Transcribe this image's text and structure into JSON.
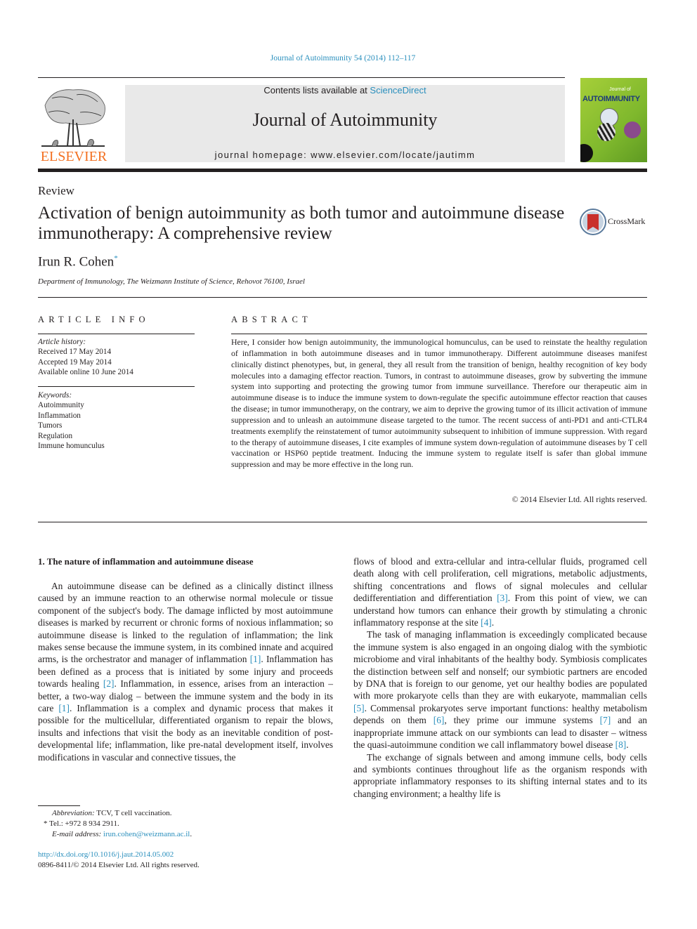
{
  "header": {
    "journal_reference": "Journal of Autoimmunity 54 (2014) 112–117",
    "contents_prefix": "Contents lists available at ",
    "contents_link": "ScienceDirect",
    "journal_name": "Journal of Autoimmunity",
    "homepage": "journal homepage: www.elsevier.com/locate/jautimm",
    "publisher_logo_text": "ELSEVIER",
    "cover": {
      "line1": "Journal of",
      "line2": "AUTOIMMUNITY"
    },
    "colors": {
      "link": "#2a8fbd",
      "publisher_orange": "#f37021",
      "band_gray": "#e9e9e9",
      "cover_green": "#8cc63f"
    }
  },
  "article": {
    "section_type": "Review",
    "title": "Activation of benign autoimmunity as both tumor and autoimmune disease immunotherapy: A comprehensive review",
    "crossmark_label": "CrossMark",
    "author": "Irun R. Cohen",
    "author_mark": "*",
    "affiliation": "Department of Immunology, The Weizmann Institute of Science, Rehovot 76100, Israel"
  },
  "article_info": {
    "heading": "ARTICLE INFO",
    "history_label": "Article history:",
    "history": [
      "Received 17 May 2014",
      "Accepted 19 May 2014",
      "Available online 10 June 2014"
    ],
    "keywords_label": "Keywords:",
    "keywords": [
      "Autoimmunity",
      "Inflammation",
      "Tumors",
      "Regulation",
      "Immune homunculus"
    ]
  },
  "abstract": {
    "heading": "ABSTRACT",
    "text": "Here, I consider how benign autoimmunity, the immunological homunculus, can be used to reinstate the healthy regulation of inflammation in both autoimmune diseases and in tumor immunotherapy. Different autoimmune diseases manifest clinically distinct phenotypes, but, in general, they all result from the transition of benign, healthy recognition of key body molecules into a damaging effector reaction. Tumors, in contrast to autoimmune diseases, grow by subverting the immune system into supporting and protecting the growing tumor from immune surveillance. Therefore our therapeutic aim in autoimmune disease is to induce the immune system to down-regulate the specific autoimmune effector reaction that causes the disease; in tumor immunotherapy, on the contrary, we aim to deprive the growing tumor of its illicit activation of immune suppression and to unleash an autoimmune disease targeted to the tumor. The recent success of anti-PD1 and anti-CTLR4 treatments exemplify the reinstatement of tumor autoimmunity subsequent to inhibition of immune suppression. With regard to the therapy of autoimmune diseases, I cite examples of immune system down-regulation of autoimmune diseases by T cell vaccination or HSP60 peptide treatment. Inducing the immune system to regulate itself is safer than global immune suppression and may be more effective in the long run.",
    "copyright": "© 2014 Elsevier Ltd. All rights reserved."
  },
  "body": {
    "section1_heading": "1.  The nature of inflammation and autoimmune disease",
    "left_para1": [
      {
        "t": "An autoimmune disease can be defined as a clinically distinct illness caused by an immune reaction to an otherwise normal molecule or tissue component of the subject's body. The damage inflicted by most autoimmune diseases is marked by recurrent or chronic forms of noxious inflammation; so autoimmune disease is linked to the regulation of inflammation; the link makes sense because the immune system, in its combined innate and acquired arms, is the orchestrator and manager of inflammation "
      },
      {
        "ref": "[1]"
      },
      {
        "t": ". Inflammation has been defined as a process that is initiated by some injury and proceeds towards healing "
      },
      {
        "ref": "[2]"
      },
      {
        "t": ". Inflammation, in essence, arises from an interaction – better, a two-way dialog – between the immune system and the body in its care "
      },
      {
        "ref": "[1]"
      },
      {
        "t": ". Inflammation is a complex and dynamic process that makes it possible for the multicellular, differentiated organism to repair the blows, insults and infections that visit the body as an inevitable condition of post-developmental life; inflammation, like pre-natal development itself, involves modifications in vascular and connective tissues, the"
      }
    ],
    "right_para1": [
      {
        "t": "flows of blood and extra-cellular and intra-cellular fluids, programed cell death along with cell proliferation, cell migrations, metabolic adjustments, shifting concentrations and flows of signal molecules and cellular dedifferentiation and differentiation "
      },
      {
        "ref": "[3]"
      },
      {
        "t": ". From this point of view, we can understand how tumors can enhance their growth by stimulating a chronic inflammatory response at the site "
      },
      {
        "ref": "[4]"
      },
      {
        "t": "."
      }
    ],
    "right_para2": [
      {
        "t": "The task of managing inflammation is exceedingly complicated because the immune system is also engaged in an ongoing dialog with the symbiotic microbiome and viral inhabitants of the healthy body. Symbiosis complicates the distinction between self and nonself; our symbiotic partners are encoded by DNA that is foreign to our genome, yet our healthy bodies are populated with more prokaryote cells than they are with eukaryote, mammalian cells "
      },
      {
        "ref": "[5]"
      },
      {
        "t": ". Commensal prokaryotes serve important functions: healthy metabolism depends on them "
      },
      {
        "ref": "[6]"
      },
      {
        "t": ", they prime our immune systems "
      },
      {
        "ref": "[7]"
      },
      {
        "t": " and an inappropriate immune attack on our symbionts can lead to disaster – witness the quasi-autoimmune condition we call inflammatory bowel disease "
      },
      {
        "ref": "[8]"
      },
      {
        "t": "."
      }
    ],
    "right_para3": [
      {
        "t": "The exchange of signals between and among immune cells, body cells and symbionts continues throughout life as the organism responds with appropriate inflammatory responses to its shifting internal states and to its changing environment; a healthy life is"
      }
    ]
  },
  "footnotes": {
    "abbreviation_label": "Abbreviation:",
    "abbreviation_text": " TCV, T cell vaccination.",
    "tel_mark": "*",
    "tel": " Tel.: +972 8 934 2911.",
    "email_label": "E-mail address:",
    "email": "irun.cohen@weizmann.ac.il",
    "email_suffix": ".",
    "doi": "http://dx.doi.org/10.1016/j.jaut.2014.05.002",
    "issn_copyright": "0896-8411/© 2014 Elsevier Ltd. All rights reserved."
  }
}
